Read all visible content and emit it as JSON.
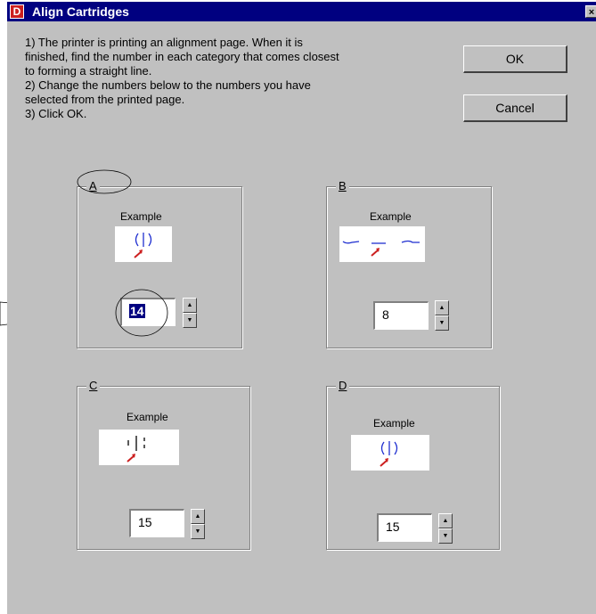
{
  "window": {
    "title": "Align Cartridges",
    "app_icon_letter": "D",
    "close_glyph": "×"
  },
  "instructions": [
    "1) The printer is printing an alignment page. When it is",
    "finished, find the number in each category that comes closest",
    "to forming a straight line.",
    "2) Change the numbers below to the numbers you have",
    "selected from the printed page.",
    "3) Click OK."
  ],
  "buttons": {
    "ok": "OK",
    "cancel": "Cancel"
  },
  "example_label": "Example",
  "groups": [
    {
      "label": "A",
      "value": "14",
      "selected": true
    },
    {
      "label": "B",
      "value": "8"
    },
    {
      "label": "C",
      "value": "15"
    },
    {
      "label": "D",
      "value": "15"
    }
  ],
  "colors": {
    "titlebar": "#000080",
    "dialog_bg": "#c0c0c0",
    "example_lines": "#1f2fd0",
    "example_arrow": "#cc1f1f"
  },
  "icons": {
    "spin_up": "▲",
    "spin_down": "▼"
  }
}
